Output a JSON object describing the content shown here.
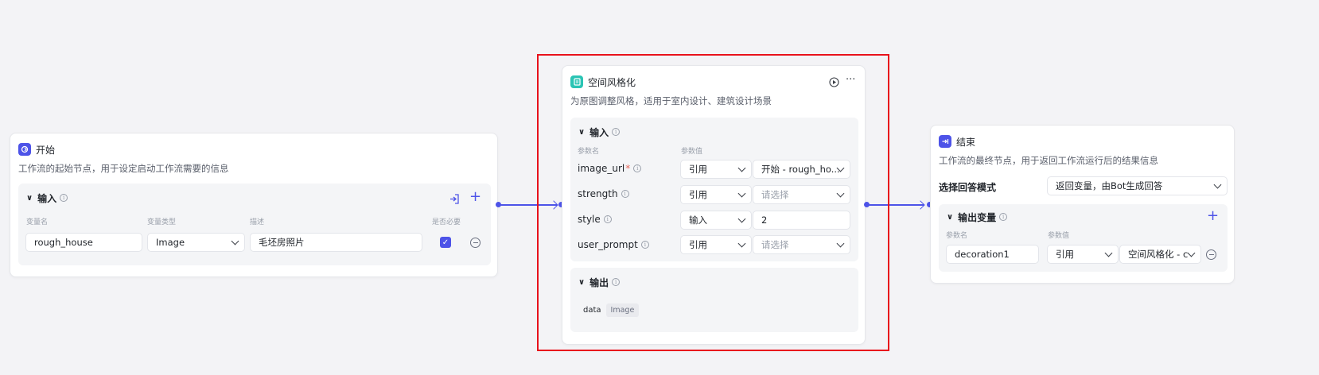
{
  "start_node": {
    "title": "开始",
    "description": "工作流的起始节点，用于设定启动工作流需要的信息",
    "input_section": {
      "title": "输入",
      "columns": [
        "变量名",
        "变量类型",
        "描述",
        "是否必要"
      ],
      "row": {
        "name": "rough_house",
        "type": "Image",
        "description": "毛坯房照片",
        "required": true
      }
    }
  },
  "style_node": {
    "title": "空间风格化",
    "description": "为原图调整风格，适用于室内设计、建筑设计场景",
    "input_section": {
      "title": "输入",
      "columns": [
        "参数名",
        "参数值"
      ],
      "params": [
        {
          "name": "image_url",
          "required": true,
          "mode": "引用",
          "value": "开始 - rough_ho...",
          "placeholder": ""
        },
        {
          "name": "strength",
          "required": false,
          "mode": "引用",
          "value": "",
          "placeholder": "请选择"
        },
        {
          "name": "style",
          "required": false,
          "mode": "输入",
          "value": "2",
          "placeholder": ""
        },
        {
          "name": "user_prompt",
          "required": false,
          "mode": "引用",
          "value": "",
          "placeholder": "请选择"
        }
      ]
    },
    "output_section": {
      "title": "输出",
      "output_name": "data",
      "output_type": "Image"
    }
  },
  "end_node": {
    "title": "结束",
    "description": "工作流的最终节点，用于返回工作流运行后的结果信息",
    "answer_mode_label": "选择回答模式",
    "answer_mode_value": "返回变量，由Bot生成回答",
    "output_section": {
      "title": "输出变量",
      "columns": [
        "参数名",
        "参数值"
      ],
      "row": {
        "name": "decoration1",
        "mode": "引用",
        "value": "空间风格化 - c"
      }
    }
  },
  "colors": {
    "accent": "#4d53e8",
    "highlight": "#e8121c",
    "style_icon": "#2bc4b4"
  },
  "icons": {
    "start": "start-icon",
    "style": "document-icon",
    "end": "end-icon"
  }
}
